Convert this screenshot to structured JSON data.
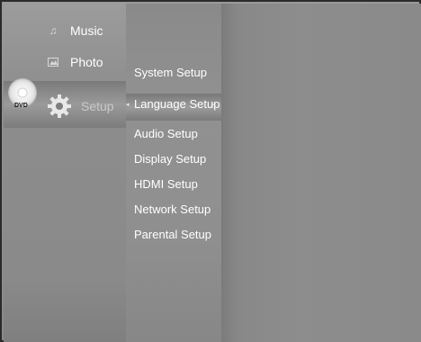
{
  "main_menu": {
    "items": [
      {
        "label": "Music",
        "icon": "music-note-icon"
      },
      {
        "label": "Photo",
        "icon": "photo-icon"
      },
      {
        "label": "Setup",
        "icon": "gear-icon"
      }
    ]
  },
  "disc": {
    "label": "DVD"
  },
  "setup_menu": {
    "items": [
      {
        "label": "System Setup"
      },
      {
        "label": "Language Setup"
      },
      {
        "label": "Audio Setup"
      },
      {
        "label": "Display Setup"
      },
      {
        "label": "HDMI Setup"
      },
      {
        "label": "Network Setup"
      },
      {
        "label": "Parental Setup"
      }
    ],
    "selected_label": "Language Setup",
    "arrow_left": "◂",
    "arrow_right": "▸"
  }
}
